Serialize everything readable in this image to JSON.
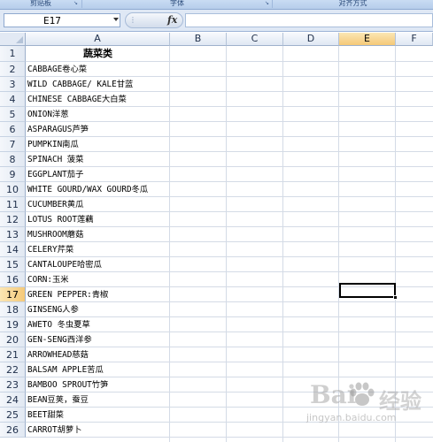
{
  "ribbon": {
    "groups": [
      "剪贴板",
      "字体",
      "对齐方式"
    ]
  },
  "formula_bar": {
    "name_box": "E17",
    "fx_label": "fx",
    "formula": ""
  },
  "columns": [
    "A",
    "B",
    "C",
    "D",
    "E",
    "F"
  ],
  "selected_column": "E",
  "selected_row": "17",
  "rows": [
    {
      "num": "1",
      "a": "蔬菜类"
    },
    {
      "num": "2",
      "a": "CABBAGE卷心菜"
    },
    {
      "num": "3",
      "a": "WILD CABBAGE/ KALE甘蓝"
    },
    {
      "num": "4",
      "a": "CHINESE CABBAGE大白菜"
    },
    {
      "num": "5",
      "a": "ONION洋葱"
    },
    {
      "num": "6",
      "a": "ASPARAGUS芦笋"
    },
    {
      "num": "7",
      "a": "PUMPKIN南瓜"
    },
    {
      "num": "8",
      "a": "SPINACH 菠菜"
    },
    {
      "num": "9",
      "a": "EGGPLANT茄子"
    },
    {
      "num": "10",
      "a": "WHITE GOURD/WAX GOURD冬瓜"
    },
    {
      "num": "11",
      "a": "CUCUMBER黄瓜"
    },
    {
      "num": "12",
      "a": "LOTUS ROOT莲藕"
    },
    {
      "num": "13",
      "a": "MUSHROOM蘑菇"
    },
    {
      "num": "14",
      "a": "CELERY芹菜"
    },
    {
      "num": "15",
      "a": "CANTALOUPE哈密瓜"
    },
    {
      "num": "16",
      "a": "CORN:玉米"
    },
    {
      "num": "17",
      "a": "GREEN PEPPER:青椒"
    },
    {
      "num": "18",
      "a": "GINSENG人参"
    },
    {
      "num": "19",
      "a": "AWETO 冬虫夏草"
    },
    {
      "num": "20",
      "a": "GEN-SENG西洋参"
    },
    {
      "num": "21",
      "a": "ARROWHEAD慈菇"
    },
    {
      "num": "22",
      "a": "BALSAM APPLE苦瓜"
    },
    {
      "num": "23",
      "a": "BAMBOO SPROUT竹笋"
    },
    {
      "num": "24",
      "a": "BEAN豆荚，蚕豆"
    },
    {
      "num": "25",
      "a": "BEET甜菜"
    },
    {
      "num": "26",
      "a": "CARROT胡萝卜"
    }
  ],
  "watermark": {
    "brand_left": "Bai",
    "brand_icon": "baidu-paw-icon",
    "brand_right": "经验",
    "url": "jingyan.baidu.com"
  },
  "colors": {
    "selection_highlight": "#f5c978",
    "header_blue": "#dfe7f3",
    "gridline": "#d4dbe6"
  }
}
